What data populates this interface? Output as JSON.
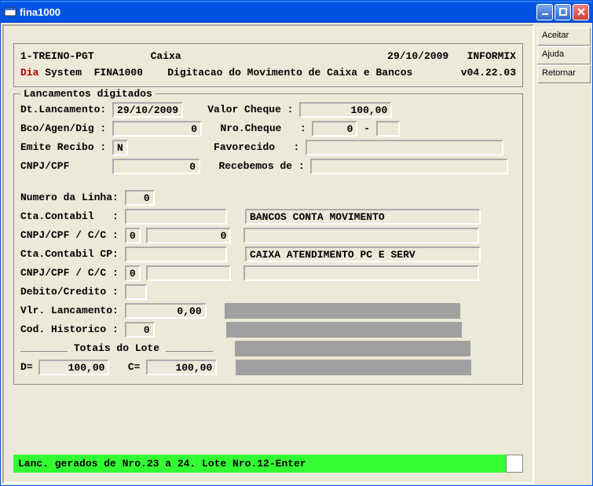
{
  "window": {
    "title": "fina1000"
  },
  "side": {
    "aceitar": "Aceitar",
    "ajuda": "Ajuda",
    "retornar": "Retornar"
  },
  "header": {
    "org": "1-TREINO-PGT",
    "module": "Caixa",
    "date": "29/10/2009",
    "db": "INFORMIX",
    "dia": "Dia",
    "system": " System  FINA1000",
    "subtitle": "Digitacao do Movimento de Caixa e Bancos",
    "version": "v04.22.03"
  },
  "lanc": {
    "legend": "Lancamentos digitados",
    "dt_label": "Dt.Lancamento:",
    "dt_value": "29/10/2009",
    "valor_label": "Valor Cheque :",
    "valor_value": "100,00",
    "bco_label": "Bco/Agen/Dig :",
    "bco_value": "0",
    "nro_label": "Nro.Cheque   :",
    "nro_value": "0",
    "nro_dash": "-",
    "emite_label": "Emite Recibo :",
    "emite_value": "N",
    "fav_label": "Favorecido   :",
    "fav_value": "",
    "cnpj_label": "CNPJ/CPF",
    "cnpj_value": "0",
    "receb_label": "Recebemos de :",
    "receb_value": ""
  },
  "linha": {
    "num_label": "Numero da Linha:",
    "num_value": "0",
    "cta_label": "Cta.Contabil   :",
    "cta_value": "",
    "cta_desc": "BANCOS CONTA MOVIMENTO",
    "cnpjcc_label": "CNPJ/CPF / C/C :",
    "cnpjcc_a": "0",
    "cnpjcc_b": "0",
    "ctacp_label": "Cta.Contabil CP:",
    "ctacp_value": "",
    "ctacp_desc": "CAIXA ATENDIMENTO PC E SERV",
    "cnpjcc2_label": "CNPJ/CPF / C/C :",
    "cnpjcc2_a": "0",
    "cnpjcc2_b": "",
    "dc_label": "Debito/Credito :",
    "dc_value": "",
    "vlr_label": "Vlr. Lancamento:",
    "vlr_value": "0,00",
    "hist_label": "Cod. Historico :",
    "hist_value": "0",
    "totais_label": "Totais do Lote",
    "d_label": "D=",
    "d_value": "100,00",
    "c_label": "C=",
    "c_value": "100,00"
  },
  "status": {
    "text": "Lanc. gerados de Nro.23 a 24. Lote Nro.12-Enter"
  }
}
